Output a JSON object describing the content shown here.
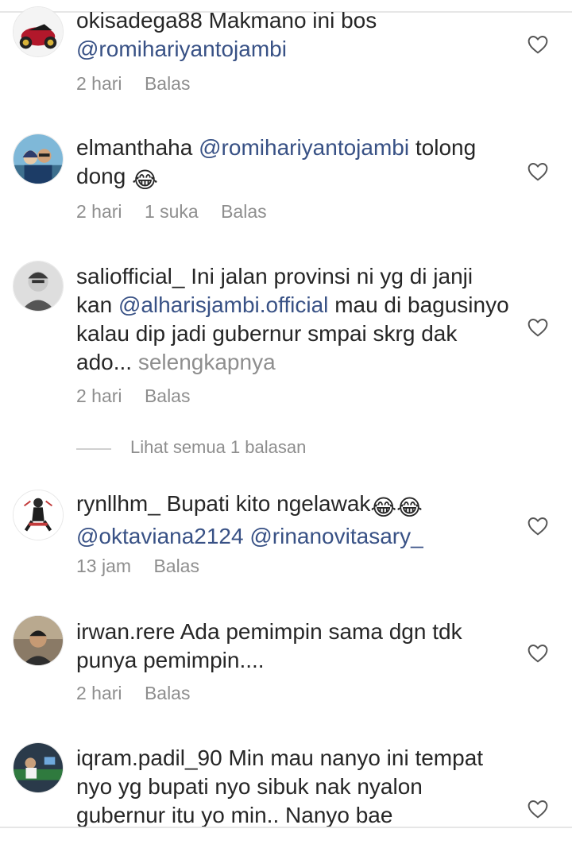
{
  "comments": [
    {
      "username": "okisadega88",
      "text": "Makmano ini bos",
      "mention": "@romihariyantojambi",
      "time": "2 hari",
      "reply": "Balas"
    },
    {
      "username": "elmanthaha",
      "mention": "@romihariyantojambi",
      "text": "tolong dong",
      "emoji": "😂",
      "time": "2 hari",
      "likes": "1 suka",
      "reply": "Balas"
    },
    {
      "username": "saliofficial_",
      "text_before": "Ini jalan provinsi ni yg di janji kan",
      "mention": "@alharisjambi.official",
      "text_after": "mau di bagusinyo kalau dip jadi gubernur smpai skrg dak ado...",
      "more": "selengkapnya",
      "time": "2 hari",
      "reply": "Balas",
      "view_replies": "Lihat semua 1 balasan"
    },
    {
      "username": "rynllhm_",
      "text": "Bupati kito ngelawak",
      "emoji": "😂😂",
      "mention1": "@oktaviana2124",
      "mention2": "@rinanovitasary_",
      "time": "13 jam",
      "reply": "Balas"
    },
    {
      "username": "irwan.rere",
      "text": "Ada pemimpin sama dgn tdk punya pemimpin....",
      "time": "2 hari",
      "reply": "Balas"
    },
    {
      "username": "iqram.padil_90",
      "text": "Min mau nanyo ini tempat nyo yg bupati nyo sibuk nak nyalon gubernur itu yo min.. Nanyo bae"
    }
  ],
  "colors": {
    "mention": "#385185",
    "meta": "#8e8e8e",
    "text": "#262626"
  },
  "icons": {
    "like": "heart-outline-icon"
  }
}
